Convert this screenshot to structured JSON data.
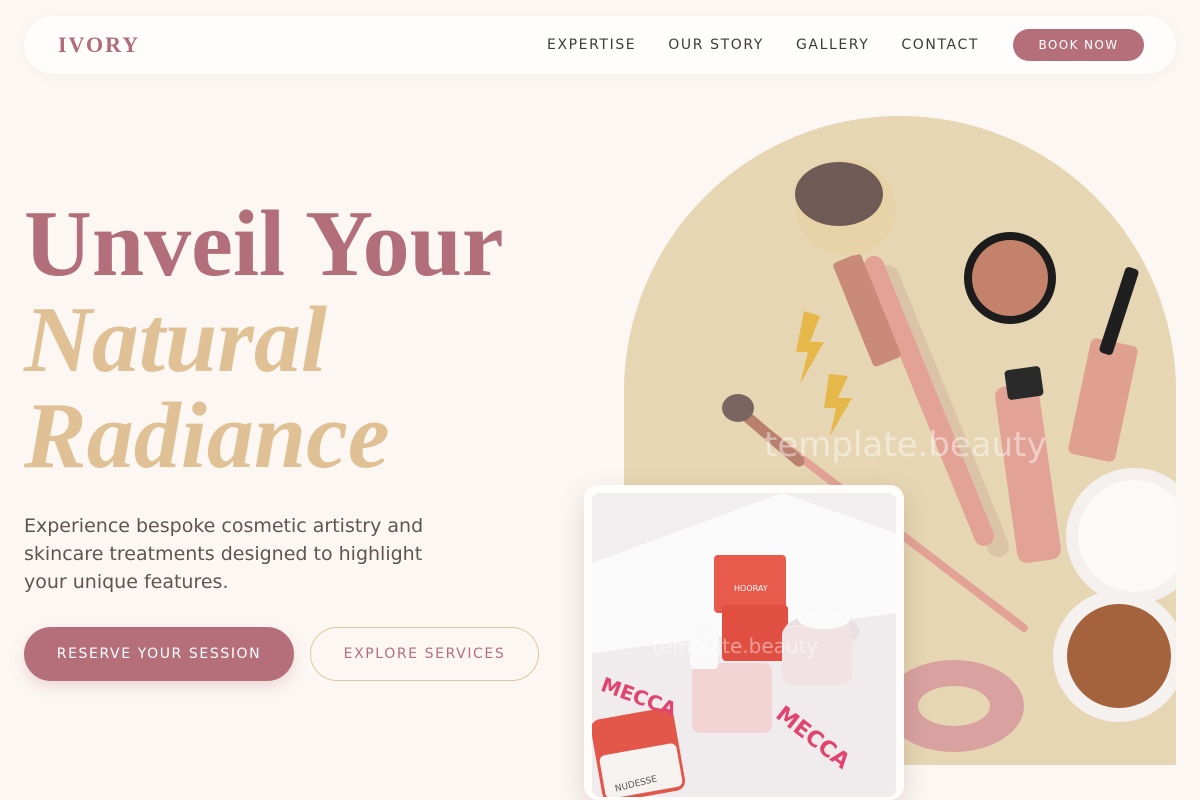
{
  "brand": {
    "logo": "IVORY"
  },
  "nav": {
    "links": [
      "EXPERTISE",
      "OUR STORY",
      "GALLERY",
      "CONTACT"
    ],
    "book_label": "BOOK NOW"
  },
  "hero": {
    "line1": "Unveil Your",
    "line2": "Natural",
    "line3": "Radiance",
    "subtext": "Experience bespoke cosmetic artistry and skincare treatments designed to highlight your unique features.",
    "cta_primary": "RESERVE YOUR SESSION",
    "cta_secondary": "EXPLORE SERVICES"
  },
  "images": {
    "main_watermark": "template.beauty",
    "card_watermark": "template.beauty",
    "card_box_brand": "MECCA",
    "card_jar_label": "NUDESSE",
    "card_product_label": "HOORAY"
  },
  "colors": {
    "accent": "#b56f7b",
    "gold": "#e0c196",
    "background": "#fcf7f3",
    "arch_bg": "#e6d6b3"
  }
}
